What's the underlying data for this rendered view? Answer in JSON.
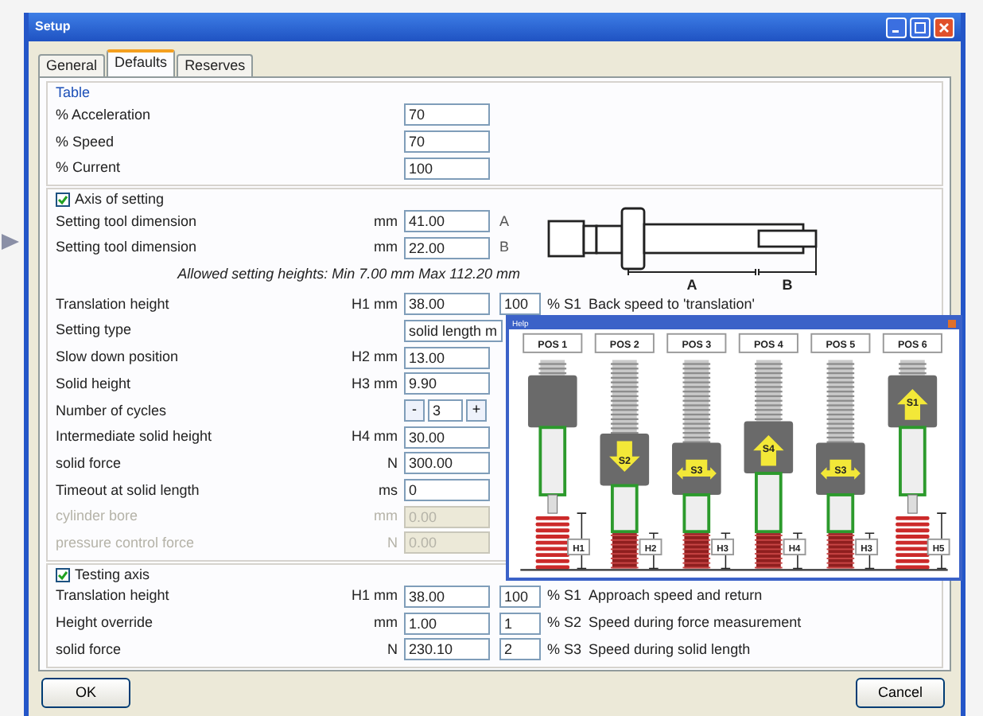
{
  "window": {
    "title": "Setup"
  },
  "tabs": [
    {
      "label": "General",
      "selected": false
    },
    {
      "label": "Defaults",
      "selected": true
    },
    {
      "label": "Reserves",
      "selected": false
    }
  ],
  "table_group": {
    "title": "Table",
    "rows": [
      {
        "label": "% Acceleration",
        "value": "70"
      },
      {
        "label": "% Speed",
        "value": "70"
      },
      {
        "label": "% Current",
        "value": "100"
      }
    ]
  },
  "axis_group": {
    "title": "Axis of setting",
    "checked": true,
    "tool_rows": [
      {
        "label": "Setting tool dimension",
        "unit": "mm",
        "value": "41.00",
        "letter": "A"
      },
      {
        "label": "Setting tool dimension",
        "unit": "mm",
        "value": "22.00",
        "letter": "B"
      }
    ],
    "drawing_labels": [
      "A",
      "B"
    ],
    "note": "Allowed setting heights: Min 7.00 mm Max 112.20 mm",
    "rows": [
      {
        "kind": "field",
        "label": "Translation height",
        "unit": "H1 mm",
        "value": "38.00",
        "disabled": false,
        "speed": {
          "value": "100",
          "label": "% S1",
          "description": "Back speed to 'translation'"
        }
      },
      {
        "kind": "select",
        "label": "Setting type",
        "value": "solid length m",
        "disabled": false
      },
      {
        "kind": "field",
        "label": "Slow down position",
        "unit": "H2 mm",
        "value": "13.00",
        "disabled": false
      },
      {
        "kind": "field",
        "label": "Solid height",
        "unit": "H3 mm",
        "value": "9.90",
        "disabled": false
      },
      {
        "kind": "spinner",
        "label": "Number of cycles",
        "value": "3",
        "minus": "-",
        "plus": "+",
        "disabled": false
      },
      {
        "kind": "field",
        "label": "Intermediate solid height",
        "unit": "H4 mm",
        "value": "30.00",
        "disabled": false
      },
      {
        "kind": "field",
        "label": "solid force",
        "unit": "N",
        "value": "300.00",
        "disabled": false
      },
      {
        "kind": "field",
        "label": "Timeout at solid length",
        "unit": "ms",
        "value": "0",
        "disabled": false
      },
      {
        "kind": "field",
        "label": "cylinder bore",
        "unit": "mm",
        "value": "0.00",
        "disabled": true
      },
      {
        "kind": "field",
        "label": "pressure control force",
        "unit": "N",
        "value": "0.00",
        "disabled": true
      }
    ]
  },
  "help_window": {
    "title": "Help",
    "positions": [
      {
        "label": "POS 1",
        "kind": "none",
        "extended": true,
        "height_label": "H1"
      },
      {
        "label": "POS 2",
        "kind": "down",
        "arrow_label": "S2",
        "extended": false,
        "height_label": "H2"
      },
      {
        "label": "POS 3",
        "kind": "sideways",
        "arrow_label": "S3",
        "extended": false,
        "height_label": "H3"
      },
      {
        "label": "POS 4",
        "kind": "up",
        "arrow_label": "S4",
        "extended": false,
        "height_label": "H4"
      },
      {
        "label": "POS 5",
        "kind": "sideways",
        "arrow_label": "S3",
        "extended": false,
        "height_label": "H3"
      },
      {
        "label": "POS 6",
        "kind": "up",
        "arrow_label": "S1",
        "extended": true,
        "height_label": "H5"
      }
    ]
  },
  "testing_group": {
    "title": "Testing axis",
    "checked": true,
    "rows": [
      {
        "kind": "field",
        "label": "Translation height",
        "unit": "H1 mm",
        "value": "38.00",
        "disabled": false,
        "speed": {
          "value": "100",
          "label": "% S1",
          "description": "Approach speed and return"
        }
      },
      {
        "kind": "field",
        "label": "Height override",
        "unit": "mm",
        "value": "1.00",
        "disabled": false,
        "speed": {
          "value": "1",
          "label": "% S2",
          "description": "Speed during force measurement"
        }
      },
      {
        "kind": "field",
        "label": "solid force",
        "unit": "N",
        "value": "230.10",
        "disabled": false,
        "speed": {
          "value": "2",
          "label": "% S3",
          "description": "Speed during solid length"
        }
      }
    ]
  },
  "buttons": [
    {
      "label": "OK"
    },
    {
      "label": "Cancel"
    }
  ]
}
